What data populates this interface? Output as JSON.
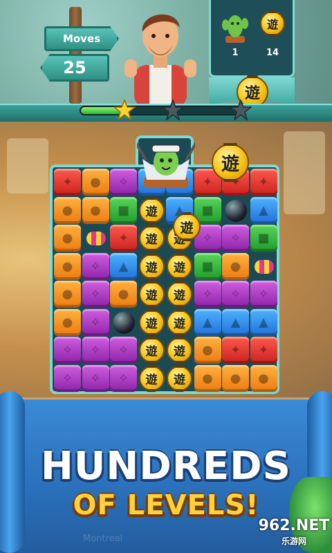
{
  "moves": {
    "label": "Moves",
    "value": "25"
  },
  "goals": [
    {
      "icon": "cactus-icon",
      "count": "1"
    },
    {
      "icon": "lantern-icon",
      "count": "14"
    }
  ],
  "lantern_glyph": "遊",
  "progress": {
    "fraction": 0.27,
    "stars_earned": 1,
    "stars_total": 3
  },
  "board": {
    "rows": [
      [
        "red",
        "orange",
        "purple",
        "blue",
        "blue",
        "red",
        "red",
        "red"
      ],
      [
        "orange",
        "orange",
        "green",
        "lantern",
        "blue",
        "green",
        "bomb",
        "blue"
      ],
      [
        "orange",
        "candy",
        "red",
        "lantern",
        "lantern",
        "purple",
        "purple",
        "green"
      ],
      [
        "orange",
        "purple",
        "blue",
        "lantern",
        "lantern",
        "green",
        "orange",
        "candy"
      ],
      [
        "orange",
        "purple",
        "orange",
        "lantern",
        "lantern",
        "purple",
        "purple",
        "purple"
      ],
      [
        "orange",
        "purple",
        "bomb",
        "lantern",
        "lantern",
        "blue",
        "blue",
        "blue"
      ],
      [
        "purple",
        "purple",
        "purple",
        "lantern",
        "lantern",
        "orange",
        "red",
        "red"
      ],
      [
        "purple",
        "purple",
        "purple",
        "lantern",
        "lantern",
        "orange",
        "orange",
        "orange"
      ]
    ]
  },
  "banner": {
    "line1": "HUNDREDS",
    "line2": "OF LEVELS!"
  },
  "map_labels": [
    "Montreal"
  ],
  "watermark": {
    "main": "962.NET",
    "sub": "乐游网"
  },
  "colors": {
    "red": "#e5312b",
    "orange": "#f5931f",
    "purple": "#b23fd0",
    "green": "#34b83a",
    "blue": "#2f8ff0",
    "accent": "#7fd8d1"
  }
}
